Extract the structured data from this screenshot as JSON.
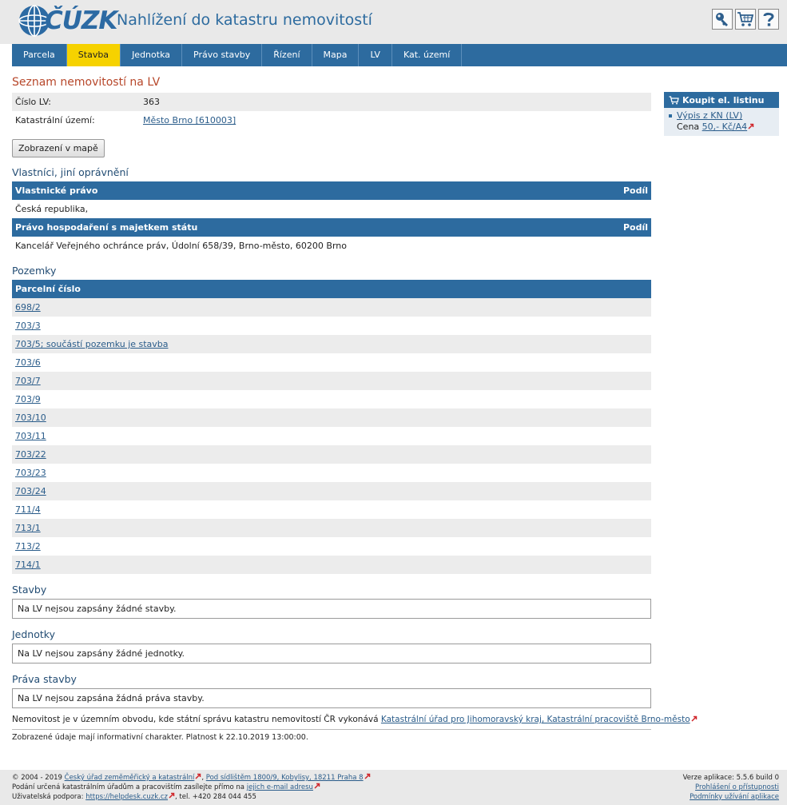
{
  "header": {
    "logo_text": "ČÚZK",
    "app_title": "Nahlížení do katastru nemovitostí",
    "tools": [
      {
        "icon": "key-icon"
      },
      {
        "icon": "cart-icon"
      },
      {
        "icon": "help-icon"
      }
    ]
  },
  "nav": {
    "items": [
      "Parcela",
      "Stavba",
      "Jednotka",
      "Právo stavby",
      "Řízení",
      "Mapa",
      "LV",
      "Kat. území"
    ],
    "active": "Stavba"
  },
  "main": {
    "title": "Seznam nemovitostí na LV",
    "info": {
      "lv_label": "Číslo LV:",
      "lv_value": "363",
      "ku_label": "Katastrální území:",
      "ku_value": "Město Brno [610003]"
    },
    "map_button": "Zobrazení v mapě",
    "owners": {
      "title": "Vlastníci, jiní oprávnění",
      "group1_header": "Vlastnické právo",
      "group1_share": "Podíl",
      "group1_row": "Česká republika,",
      "group2_header": "Právo hospodaření s majetkem státu",
      "group2_share": "Podíl",
      "group2_row": "Kancelář Veřejného ochránce práv, Údolní 658/39, Brno-město, 60200 Brno"
    },
    "parcels": {
      "title": "Pozemky",
      "header": "Parcelní číslo",
      "rows": [
        "698/2",
        "703/3",
        "703/5; součástí pozemku je stavba",
        "703/6",
        "703/7",
        "703/9",
        "703/10",
        "703/11",
        "703/22",
        "703/23",
        "703/24",
        "711/4",
        "713/1",
        "713/2",
        "714/1"
      ]
    },
    "buildings": {
      "title": "Stavby",
      "empty": "Na LV nejsou zapsány žádné stavby."
    },
    "units": {
      "title": "Jednotky",
      "empty": "Na LV nejsou zapsány žádné jednotky."
    },
    "rights": {
      "title": "Práva stavby",
      "empty": "Na LV nejsou zapsána žádná práva stavby."
    },
    "office_text": "Nemovitost je v územním obvodu, kde státní správu katastru nemovitostí ČR vykonává",
    "office_link": "Katastrální úřad pro Jihomoravský kraj, Katastrální pracoviště Brno-město",
    "validity": "Zobrazené údaje mají informativní charakter. Platnost k 22.10.2019 13:00:00."
  },
  "sidebar": {
    "title": "Koupit el. listinu",
    "item_link": "Výpis z KN (LV)",
    "price_label": "Cena",
    "price_link": "50,- Kč/A4"
  },
  "footer": {
    "copyright": "© 2004 - 2019",
    "org_link": "Český úřad zeměměřický a katastrální",
    "address_link": "Pod sídlištěm 1800/9, Kobylisy, 18211 Praha 8",
    "submission_text": "Podání určená katastrálním úřadům a pracovištím zasílejte přímo na",
    "submission_link": "jejich e-mail adresu",
    "support_label": "Uživatelská podpora:",
    "support_link": "https://helpdesk.cuzk.cz",
    "phone": "tel. +420 284 044 455",
    "version": "Verze aplikace: 5.5.6 build 0",
    "accessibility_link": "Prohlášení o přístupnosti",
    "terms_link": "Podmínky užívání aplikace"
  },
  "colors": {
    "primary": "#2d6b9f",
    "active_tab": "#f6d200",
    "title": "#b7472a",
    "link": "#2a5c8a"
  }
}
